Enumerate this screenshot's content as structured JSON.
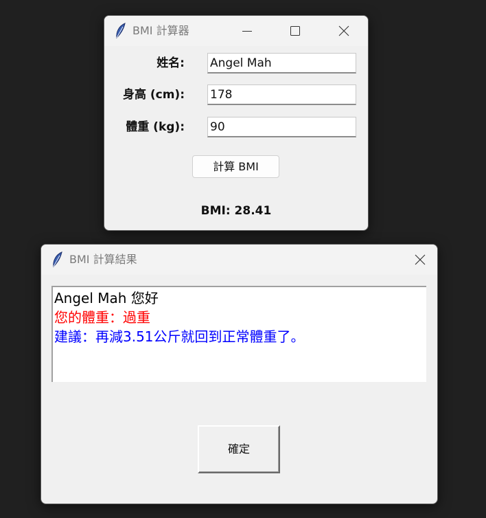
{
  "calc_window": {
    "title": "BMI 計算器",
    "fields": [
      {
        "label": "姓名:",
        "value": "Angel Mah"
      },
      {
        "label": "身高 (cm):",
        "value": "178"
      },
      {
        "label": "體重 (kg):",
        "value": "90"
      }
    ],
    "calc_button_label": "計算 BMI",
    "bmi_result": "BMI: 28.41"
  },
  "result_window": {
    "title": "BMI 計算結果",
    "lines": [
      {
        "text": "Angel Mah 您好",
        "color": "#000000"
      },
      {
        "text": "您的體重：過重",
        "color": "#ff0000"
      },
      {
        "text": "建議：再減3.51公斤就回到正常體重了。",
        "color": "#0000ff"
      }
    ],
    "ok_button_label": "確定"
  },
  "colors": {
    "desktop": "#202020",
    "window_bg": "#f0f0f0",
    "overweight_text": "#ff0000",
    "advice_text": "#0000ff"
  }
}
